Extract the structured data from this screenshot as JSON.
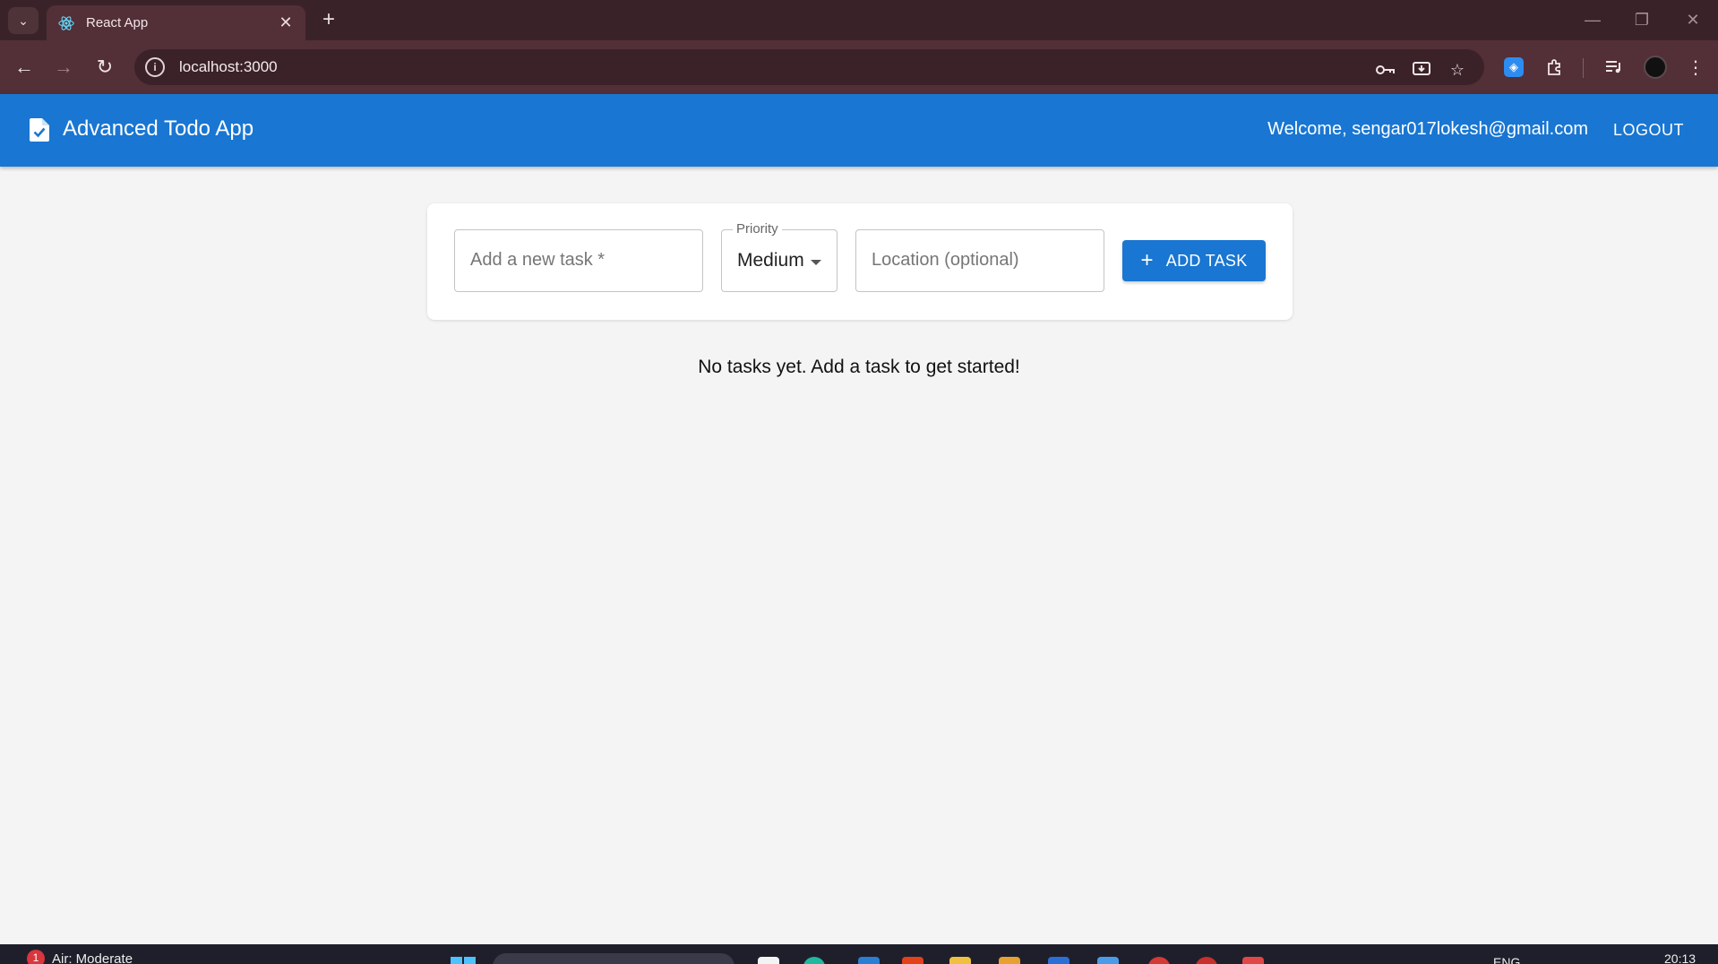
{
  "browser": {
    "tab_title": "React App",
    "url": "localhost:3000"
  },
  "app": {
    "title": "Advanced Todo App",
    "welcome_text": "Welcome, sengar017lokesh@gmail.com",
    "logout_label": "LOGOUT",
    "primary_color": "#1976d2"
  },
  "form": {
    "task_placeholder": "Add a new task *",
    "priority_label": "Priority",
    "priority_value": "Medium",
    "location_placeholder": "Location (optional)",
    "add_button_label": "ADD TASK"
  },
  "empty_message": "No tasks yet. Add a task to get started!",
  "taskbar": {
    "weather_badge": "1",
    "weather_text": "Air: Moderate",
    "language": "ENG",
    "time": "20:13"
  }
}
